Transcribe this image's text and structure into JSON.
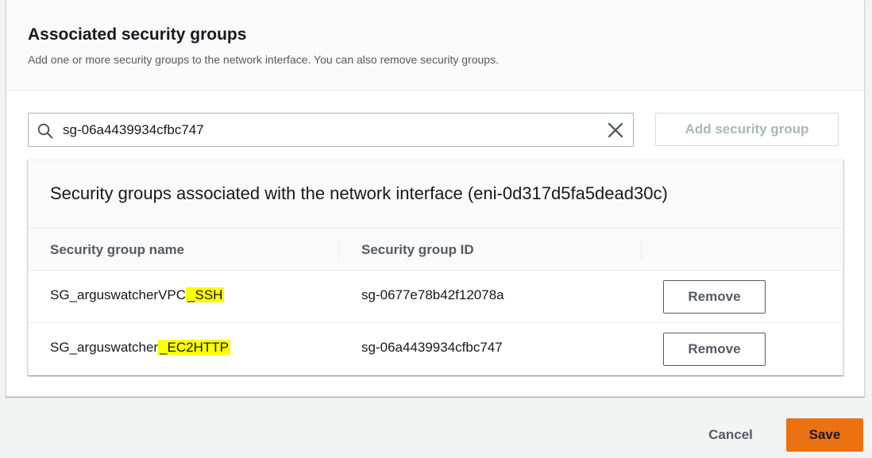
{
  "panel": {
    "title": "Associated security groups",
    "description": "Add one or more security groups to the network interface. You can also remove security groups."
  },
  "search": {
    "value": "sg-06a4439934cfbc747",
    "icon": "search-icon",
    "clear_icon": "close-icon"
  },
  "add_button_label": "Add security group",
  "table": {
    "title": "Security groups associated with the network interface (eni-0d317d5fa5dead30c)",
    "columns": [
      "Security group name",
      "Security group ID",
      ""
    ],
    "rows": [
      {
        "name_prefix": "SG_arguswatcherVPC",
        "name_highlight": "_SSH",
        "id": "sg-0677e78b42f12078a",
        "action": "Remove"
      },
      {
        "name_prefix": "SG_arguswatcher",
        "name_highlight": "_EC2HTTP",
        "id": "sg-06a4439934cfbc747",
        "action": "Remove"
      }
    ]
  },
  "footer": {
    "cancel_label": "Cancel",
    "save_label": "Save"
  },
  "colors": {
    "primary": "#ec7211",
    "highlight": "#ffff00",
    "border": "#aab7b8",
    "text_secondary": "#545b64"
  }
}
